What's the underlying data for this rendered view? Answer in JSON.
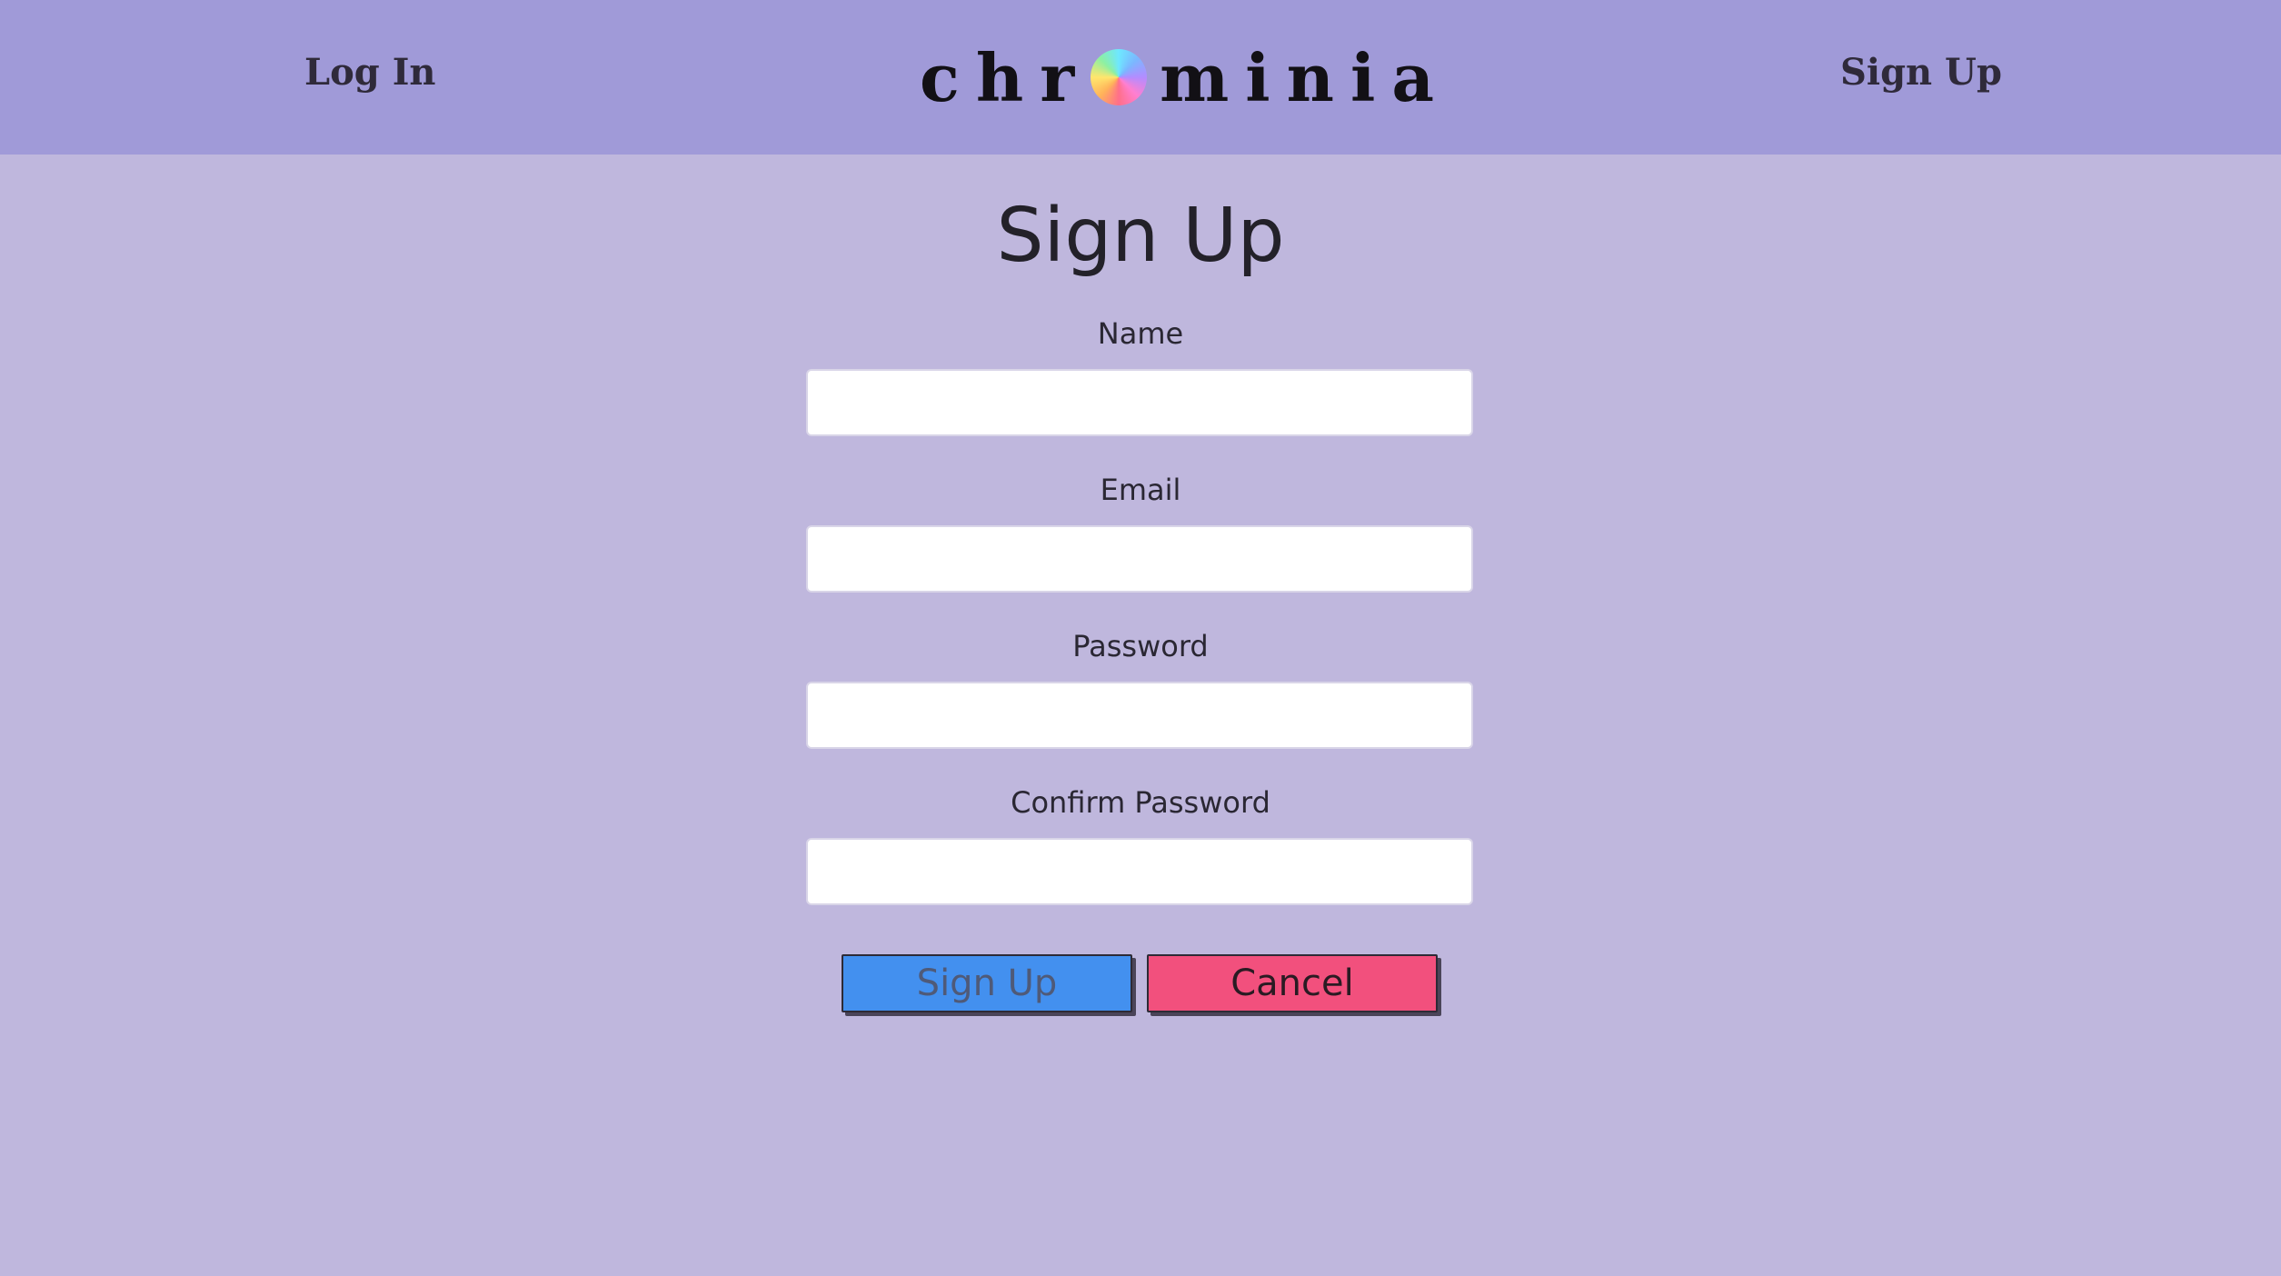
{
  "nav": {
    "login_label": "Log In",
    "signup_label": "Sign Up",
    "brand_before": "chr",
    "brand_after": "minia",
    "brand_icon": "color-wheel-icon"
  },
  "form": {
    "title": "Sign Up",
    "fields": [
      {
        "label": "Name",
        "value": "",
        "placeholder": ""
      },
      {
        "label": "Email",
        "value": "",
        "placeholder": ""
      },
      {
        "label": "Password",
        "value": "",
        "placeholder": ""
      },
      {
        "label": "Confirm Password",
        "value": "",
        "placeholder": ""
      }
    ],
    "submit_label": "Sign Up",
    "cancel_label": "Cancel"
  },
  "colors": {
    "navbar": "#a09ad8",
    "background": "#bfb7dd",
    "submit_button": "#4390ef",
    "cancel_button": "#f2507d"
  }
}
